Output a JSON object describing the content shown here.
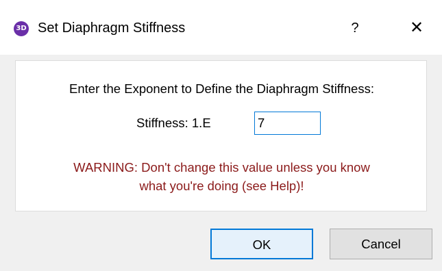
{
  "window": {
    "app_icon_text": "3D",
    "title": "Set Diaphragm Stiffness",
    "help_label": "?",
    "close_label": "✕"
  },
  "form": {
    "prompt": "Enter the Exponent to Define the Diaphragm Stiffness:",
    "stiffness_label": "Stiffness: 1.E",
    "stiffness_value": "7",
    "warning_line1": "WARNING: Don't change this value unless you know",
    "warning_line2": "what you're doing (see Help)!"
  },
  "buttons": {
    "ok": "OK",
    "cancel": "Cancel"
  },
  "colors": {
    "warning": "#8b1a1a",
    "app_icon": "#6a2fa8",
    "focus_accent": "#0078d7"
  }
}
